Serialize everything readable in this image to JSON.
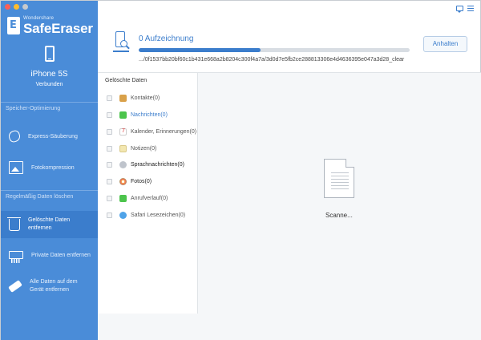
{
  "app": {
    "brand_sub": "Wondershare",
    "brand_name": "SafeEraser"
  },
  "device": {
    "name": "iPhone 5S",
    "status": "Verbunden"
  },
  "sidebar": {
    "section_storage": "Speicher-Optimierung",
    "section_regular": "Regelmäßig Daten löschen",
    "items": [
      {
        "label": "Express-Säuberung",
        "icon": "broom-icon"
      },
      {
        "label": "Fotokompression",
        "icon": "photo-icon"
      },
      {
        "label": "Gelöschte Daten entfernen",
        "icon": "trash-icon",
        "active": true
      },
      {
        "label": "Private Daten entfernen",
        "icon": "shredder-icon"
      },
      {
        "label": "Alle Daten auf dem Gerät entfernen",
        "icon": "eraser-icon"
      }
    ]
  },
  "scan": {
    "record_title": "0 Aufzeichnung",
    "device_id": ".../0f1537bb20bf60c1b431e668a2b8204c300f4a7a/3d0d7e5fb2ce288813306e4d4636395e047a3d28_clear",
    "stop_label": "Anhalten",
    "progress_fraction": 0.45,
    "status_text": "Scanne..."
  },
  "list": {
    "header": "Gelöschte Daten",
    "categories": [
      {
        "label": "Kontakte(0)",
        "icon": "contacts-icon"
      },
      {
        "label": "Nachrichten(0)",
        "icon": "messages-icon",
        "active": true
      },
      {
        "label": "Kalender, Erinnerungen(0)",
        "icon": "calendar-icon"
      },
      {
        "label": "Notizen(0)",
        "icon": "notes-icon"
      },
      {
        "label": "Sprachnachrichten(0)",
        "icon": "voicemail-icon",
        "bold": true
      },
      {
        "label": "Fotos(0)",
        "icon": "photos-icon",
        "bold": true
      },
      {
        "label": "Anrufverlauf(0)",
        "icon": "call-history-icon"
      },
      {
        "label": "Safari Lesezeichen(0)",
        "icon": "safari-icon"
      }
    ]
  },
  "colors": {
    "sidebar": "#4a8cd8",
    "sidebar_active": "#3b7dcc",
    "accent": "#3b7dcc"
  }
}
